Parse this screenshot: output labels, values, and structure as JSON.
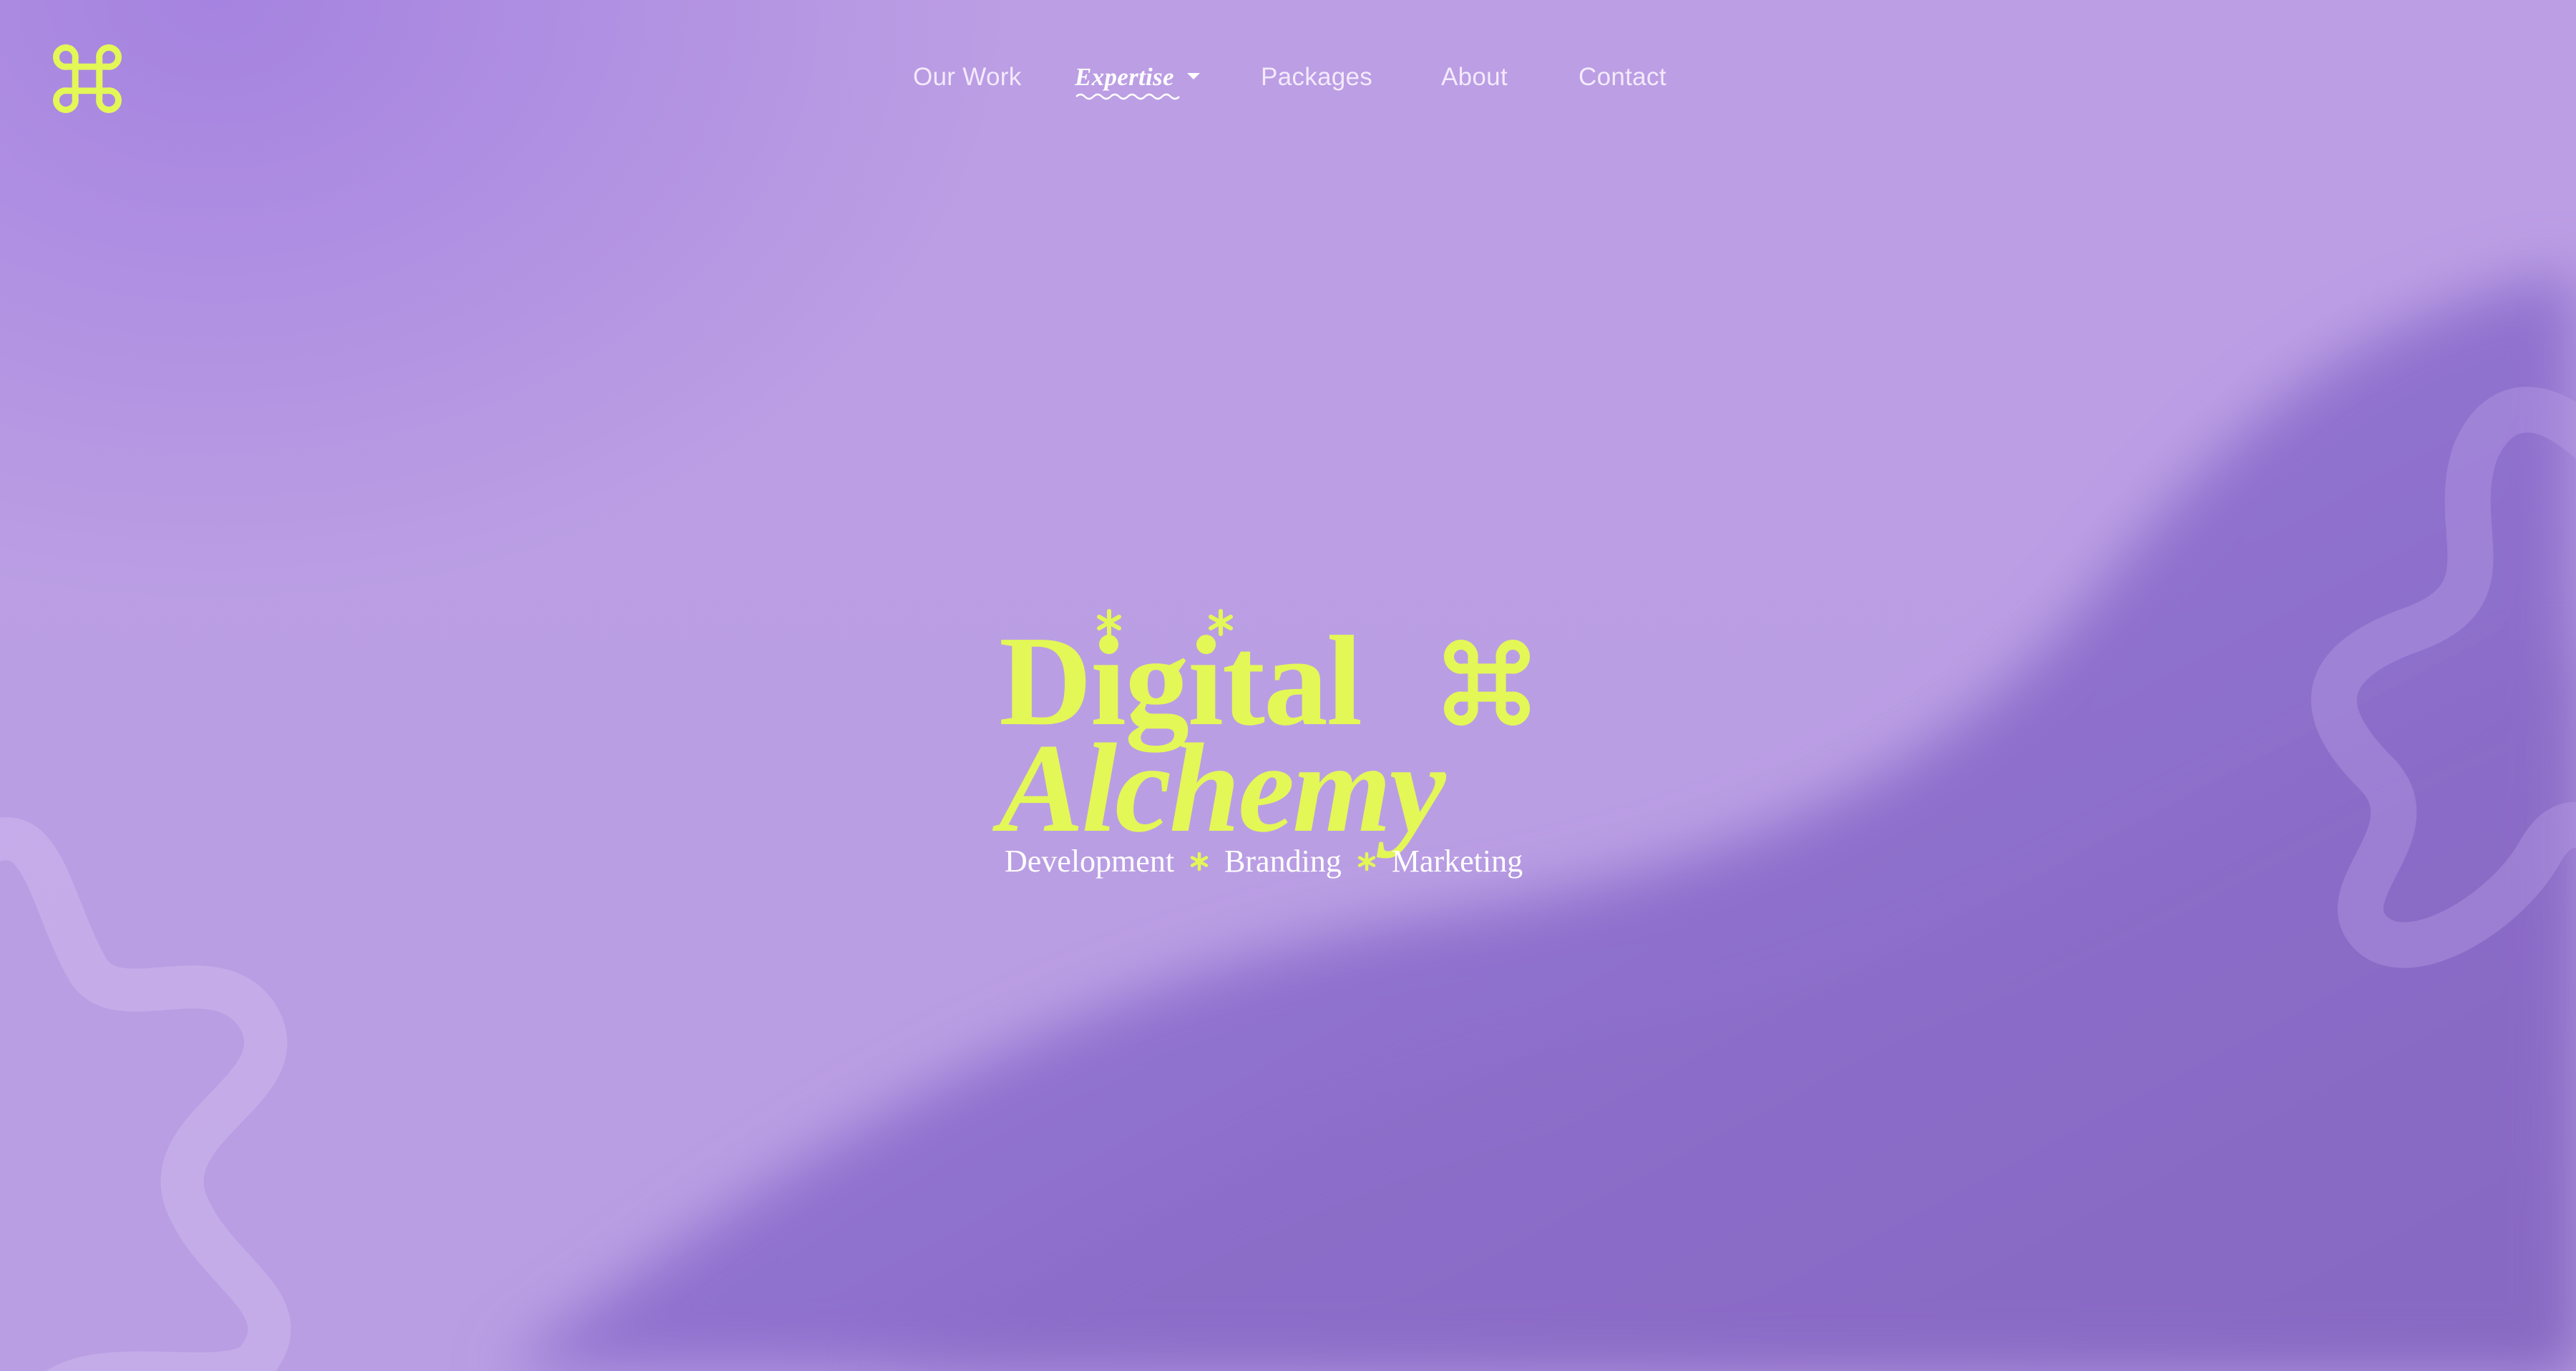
{
  "brand": {
    "logo_icon": "command-key-icon",
    "accent_color": "#e3f756"
  },
  "nav": {
    "items": [
      {
        "label": "Our Work"
      },
      {
        "label": "Expertise",
        "active": true,
        "has_dropdown": true
      },
      {
        "label": "Packages"
      },
      {
        "label": "About"
      },
      {
        "label": "Contact"
      }
    ]
  },
  "hero": {
    "line1": "Digital",
    "line2": "Alchemy",
    "tagline": {
      "items": [
        "Development",
        "Branding",
        "Marketing"
      ],
      "separator_icon": "asterisk-icon"
    }
  },
  "colors": {
    "background": "#bb9ee4",
    "background_dark": "#8a6cc4",
    "text_light": "#f3eafc"
  }
}
